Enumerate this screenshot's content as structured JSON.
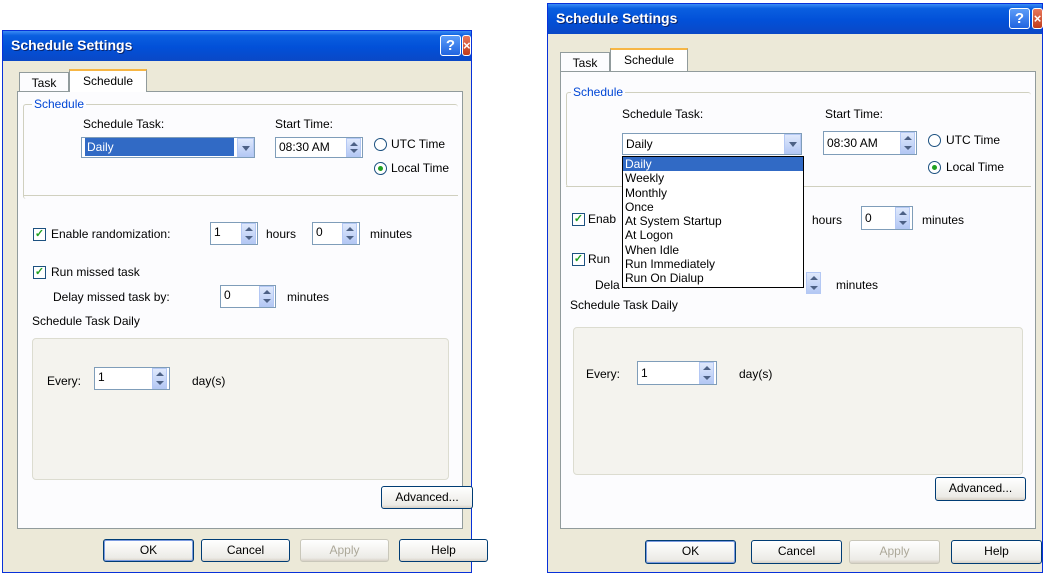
{
  "dialogs": [
    {
      "title": "Schedule Settings",
      "tabs": [
        "Task",
        "Schedule"
      ],
      "group_label": "Schedule",
      "schedule_task_label": "Schedule Task:",
      "schedule_task_value": "Daily",
      "start_time_label": "Start Time:",
      "start_time_value": "08:30 AM",
      "utc_label": "UTC Time",
      "local_label": "Local Time",
      "enable_random_label": "Enable randomization:",
      "hours_value": "1",
      "hours_label": "hours",
      "minutes_value": "0",
      "minutes_label": "minutes",
      "run_missed_label": "Run missed task",
      "delay_label": "Delay missed task by:",
      "delay_value": "0",
      "delay_minutes_label": "minutes",
      "daily_group_label": "Schedule Task Daily",
      "every_label": "Every:",
      "every_value": "1",
      "days_label": "day(s)",
      "advanced_label": "Advanced...",
      "ok_label": "OK",
      "cancel_label": "Cancel",
      "apply_label": "Apply",
      "help_label": "Help"
    },
    {
      "title": "Schedule Settings",
      "tabs": [
        "Task",
        "Schedule"
      ],
      "group_label": "Schedule",
      "schedule_task_label": "Schedule Task:",
      "schedule_task_value": "Daily",
      "start_time_label": "Start Time:",
      "start_time_value": "08:30 AM",
      "utc_label": "UTC Time",
      "local_label": "Local Time",
      "enable_random_partial": "Enab",
      "hours_label": "hours",
      "minutes_value": "0",
      "minutes_label": "minutes",
      "run_missed_partial": "Run",
      "delay_partial": "Dela",
      "delay_minutes_label": "minutes",
      "daily_group_label": "Schedule Task Daily",
      "every_label": "Every:",
      "every_value": "1",
      "days_label": "day(s)",
      "advanced_label": "Advanced...",
      "ok_label": "OK",
      "cancel_label": "Cancel",
      "apply_label": "Apply",
      "help_label": "Help",
      "dropdown_options": [
        "Daily",
        "Weekly",
        "Monthly",
        "Once",
        "At System Startup",
        "At Logon",
        "When Idle",
        "Run Immediately",
        "Run On Dialup"
      ],
      "dropdown_selected": "Daily"
    }
  ],
  "colors": {
    "title_bar": "#0250d8",
    "selection": "#316ac5",
    "check": "#21a121",
    "tab_highlight": "#f7b644"
  },
  "checkbox_state": {
    "enable_randomization": true,
    "run_missed_task": true
  },
  "radio_state": {
    "utc_time": false,
    "local_time": true
  },
  "icons": [
    "help-icon",
    "close-icon",
    "spin-up-icon",
    "spin-down-icon",
    "dropdown-arrow-icon",
    "checkmark-icon",
    "radio-dot-icon"
  ]
}
